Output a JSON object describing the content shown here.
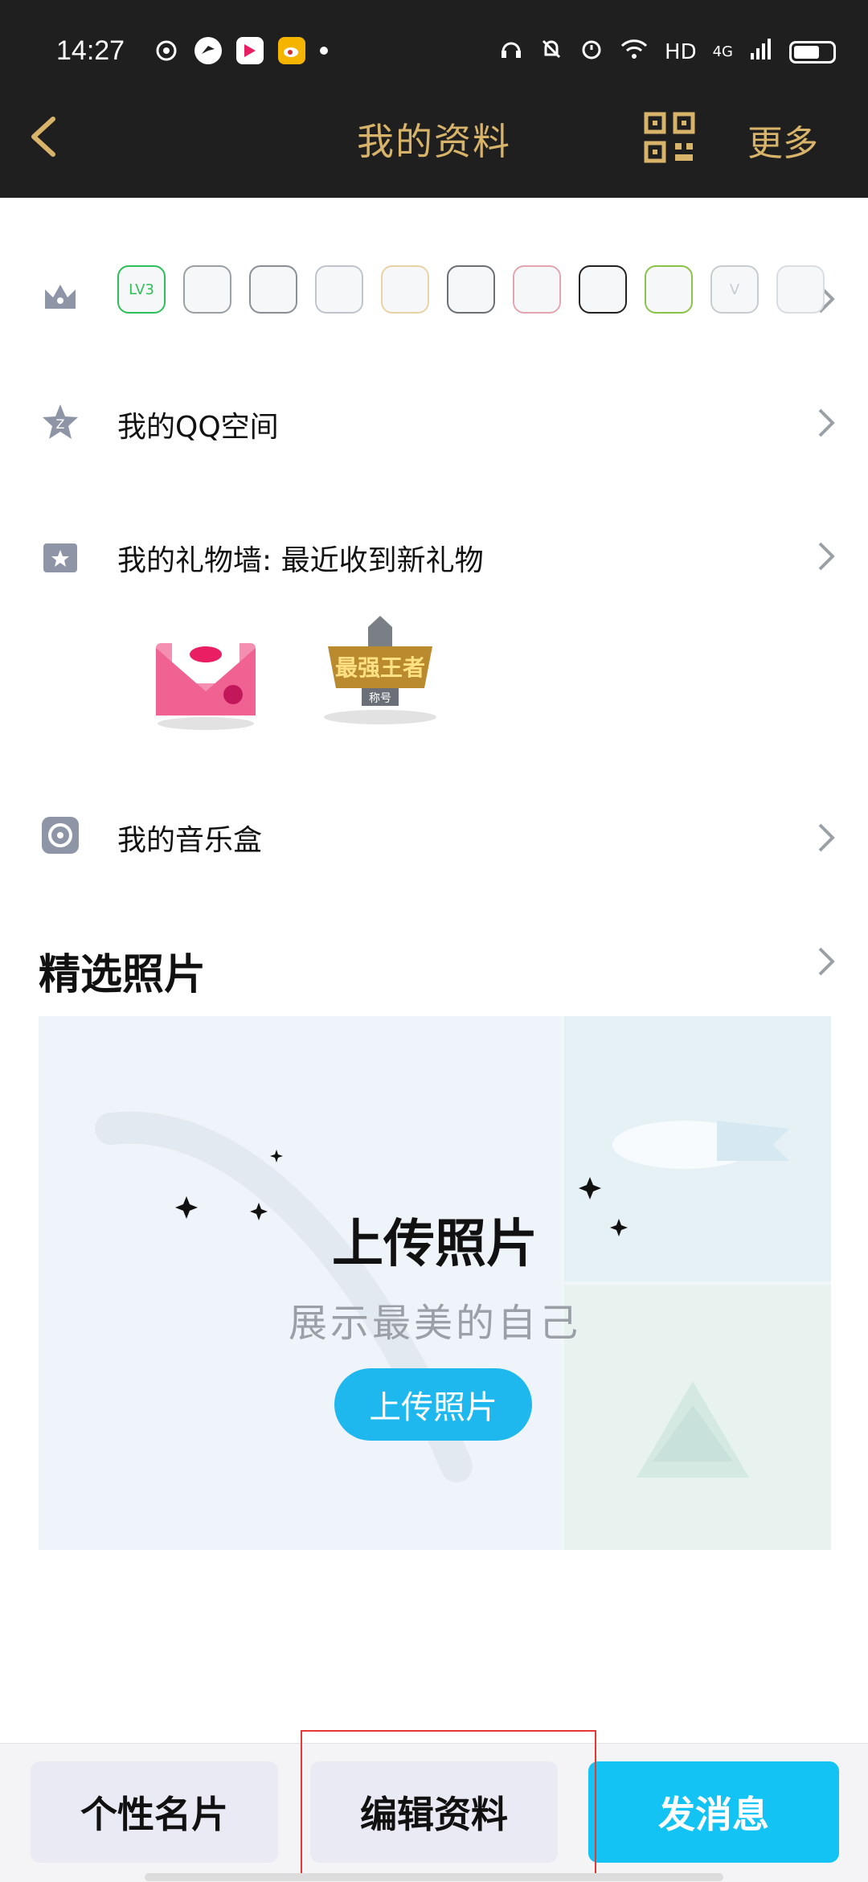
{
  "status_bar": {
    "time": "14:27",
    "right_network": "HD",
    "right_4g": "4G"
  },
  "title_bar": {
    "title": "我的资料",
    "more": "更多",
    "title_color": "#d8b36a"
  },
  "rows": {
    "qzone_label": "我的QQ空间",
    "gift_label": "我的礼物墙: 最近收到新礼物",
    "music_label": "我的音乐盒"
  },
  "badges": [
    {
      "name": "lv3-icon",
      "text": "LV3",
      "color": "#2fbf5a"
    },
    {
      "name": "eagle-badge-icon",
      "text": "",
      "color": "#9aa0a6"
    },
    {
      "name": "penguin-gray-icon",
      "text": "",
      "color": "#8a8f96"
    },
    {
      "name": "diamond-silver-icon",
      "text": "",
      "color": "#bfc5cc"
    },
    {
      "name": "diamond-heart-icon",
      "text": "",
      "color": "#e8d3a6"
    },
    {
      "name": "penguin-crown-icon",
      "text": "",
      "color": "#6c6f75"
    },
    {
      "name": "diamond-pink-icon",
      "text": "",
      "color": "#e3a6b1"
    },
    {
      "name": "penguin-black-icon",
      "text": "",
      "color": "#222"
    },
    {
      "name": "penguin-green-icon",
      "text": "",
      "color": "#8bc34a"
    },
    {
      "name": "cloud-v-icon",
      "text": "V",
      "color": "#c7ccd2"
    },
    {
      "name": "tuxedo-icon",
      "text": "",
      "color": "#d9dde2"
    }
  ],
  "gifts": [
    {
      "name": "love-letter-gift-icon"
    },
    {
      "name": "strongest-king-title-gift-icon",
      "text": "最强王者",
      "subtext": "称号"
    }
  ],
  "featured": {
    "section_title": "精选照片",
    "upload_title": "上传照片",
    "upload_subtitle": "展示最美的自己",
    "upload_button": "上传照片"
  },
  "bottom_buttons": {
    "personal_card": "个性名片",
    "edit_profile": "编辑资料",
    "send_message": "发消息"
  }
}
